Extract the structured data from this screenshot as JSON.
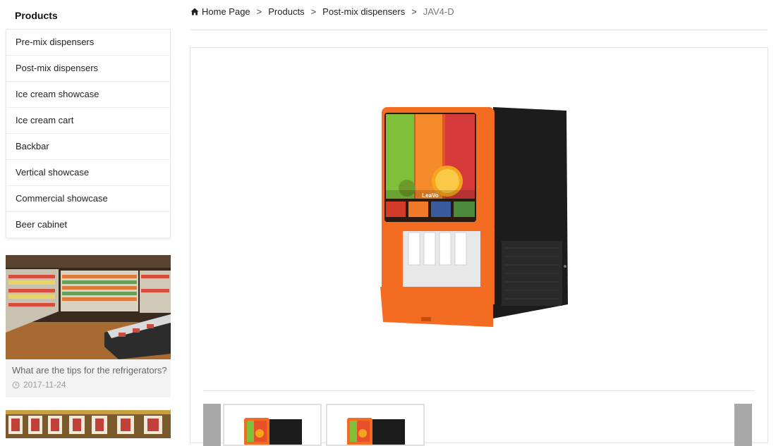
{
  "sidebar": {
    "title": "Products",
    "items": [
      {
        "label": "Pre-mix dispensers"
      },
      {
        "label": "Post-mix dispensers"
      },
      {
        "label": "Ice cream showcase"
      },
      {
        "label": "Ice cream cart"
      },
      {
        "label": "Backbar"
      },
      {
        "label": "Vertical showcase"
      },
      {
        "label": "Commercial showcase"
      },
      {
        "label": "Beer cabinet"
      }
    ]
  },
  "news": [
    {
      "title": "What are the tips for the refrigerators?",
      "date": "2017-11-24"
    }
  ],
  "breadcrumb": {
    "home": "Home Page",
    "products": "Products",
    "category": "Post-mix dispensers",
    "current": "JAV4-D",
    "separator": ">"
  },
  "product": {
    "brand_label": "LeaVo"
  },
  "colors": {
    "accent_orange": "#f36c21",
    "body_dark": "#1c1c1c",
    "nav_gray": "#a8a8a8"
  },
  "icons": {
    "home": "home-icon",
    "clock": "clock-icon",
    "prev": "chevron-left-icon",
    "next": "chevron-right-icon"
  }
}
